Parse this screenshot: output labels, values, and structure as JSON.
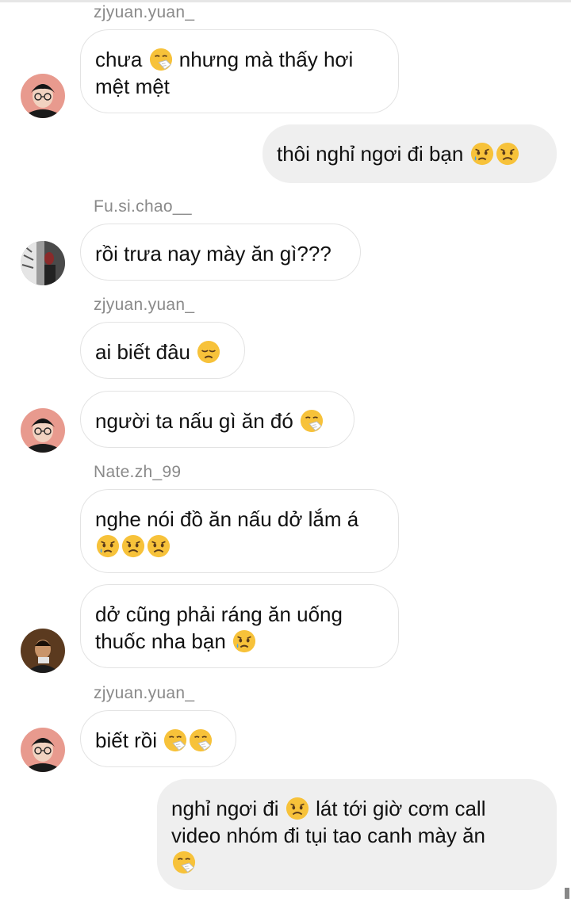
{
  "messages": [
    {
      "sender": "zjyuan.yuan_",
      "text": "chưa",
      "emoji": "sneezing-face",
      "text2": "nhưng mà thấy hơi",
      "text3": "mệt mệt"
    },
    {
      "text": "thôi nghỉ ngơi đi bạn",
      "emojis": [
        "sad-tear-face",
        "worried-face"
      ]
    },
    {
      "sender": "Fu.si.chao__",
      "text": "rồi trưa nay mày ăn gì???"
    },
    {
      "sender": "zjyuan.yuan_",
      "text": "ai biết đâu",
      "emoji": "disappointed-face"
    },
    {
      "text": "người ta nấu gì ăn đó",
      "emoji": "sneezing-face"
    },
    {
      "sender": "Nate.zh_99",
      "text": "nghe nói đồ ăn nấu dở lắm á",
      "emojis": [
        "sad-tear-face",
        "worried-face",
        "worried-face"
      ]
    },
    {
      "text": "dở cũng phải ráng ăn uống",
      "text2": "thuốc nha bạn",
      "emoji": "sad-tear-face"
    },
    {
      "sender": "zjyuan.yuan_",
      "text": "biết rồi",
      "emojis": [
        "sneezing-face",
        "sneezing-face"
      ]
    },
    {
      "text": "nghỉ ngơi đi",
      "emoji": "worried-face",
      "text2": "lát tới giờ cơm call",
      "text3": "video nhóm đi tụi tao canh mày ăn",
      "emoji2": "sneezing-face"
    }
  ],
  "colors": {
    "sent_bubble": "#efefef",
    "received_border": "#e3e3e3",
    "sender_name": "#8a8a8a",
    "emoji_yellow": "#f7c23a"
  }
}
